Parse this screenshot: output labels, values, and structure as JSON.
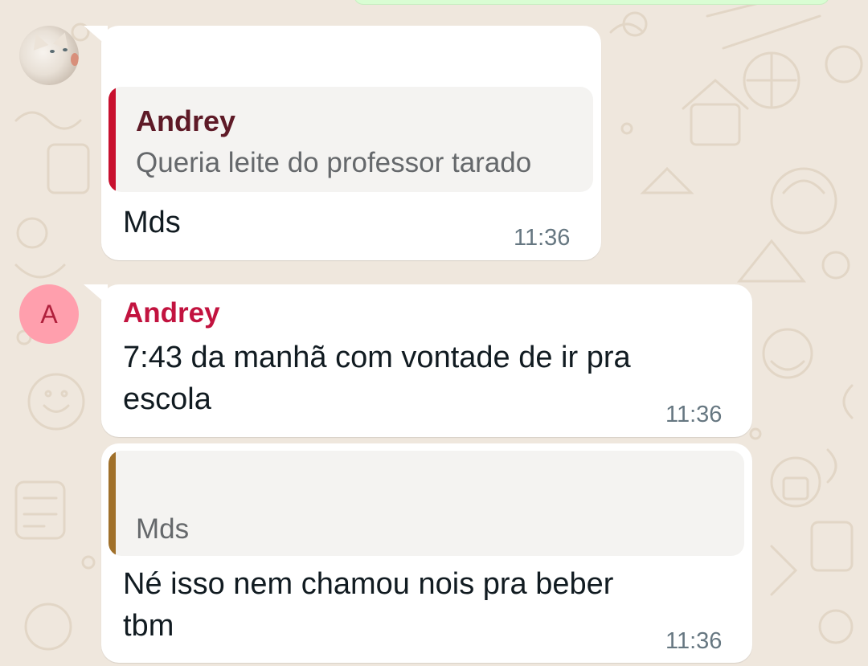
{
  "messages": [
    {
      "quote": {
        "author": "Andrey",
        "text": "Queria leite do professor tarado",
        "bar_color": "#c8102e"
      },
      "lines": [
        "Mds"
      ],
      "time": "11:36"
    },
    {
      "sender": {
        "initial": "A",
        "name": "Andrey"
      },
      "lines": [
        "7:43 da manhã com vontade de ir pra",
        "escola"
      ],
      "time": "11:36"
    },
    {
      "quote": {
        "text": "Mds",
        "bar_color": "#a0702a"
      },
      "lines": [
        "Né isso nem chamou nois pra beber",
        "tbm"
      ],
      "time": "11:36"
    }
  ],
  "colors": {
    "wallpaper": "#efe7dd",
    "bubble": "#ffffff",
    "sender_name": "#c2133f",
    "avatar_bg": "#ff9fad"
  }
}
